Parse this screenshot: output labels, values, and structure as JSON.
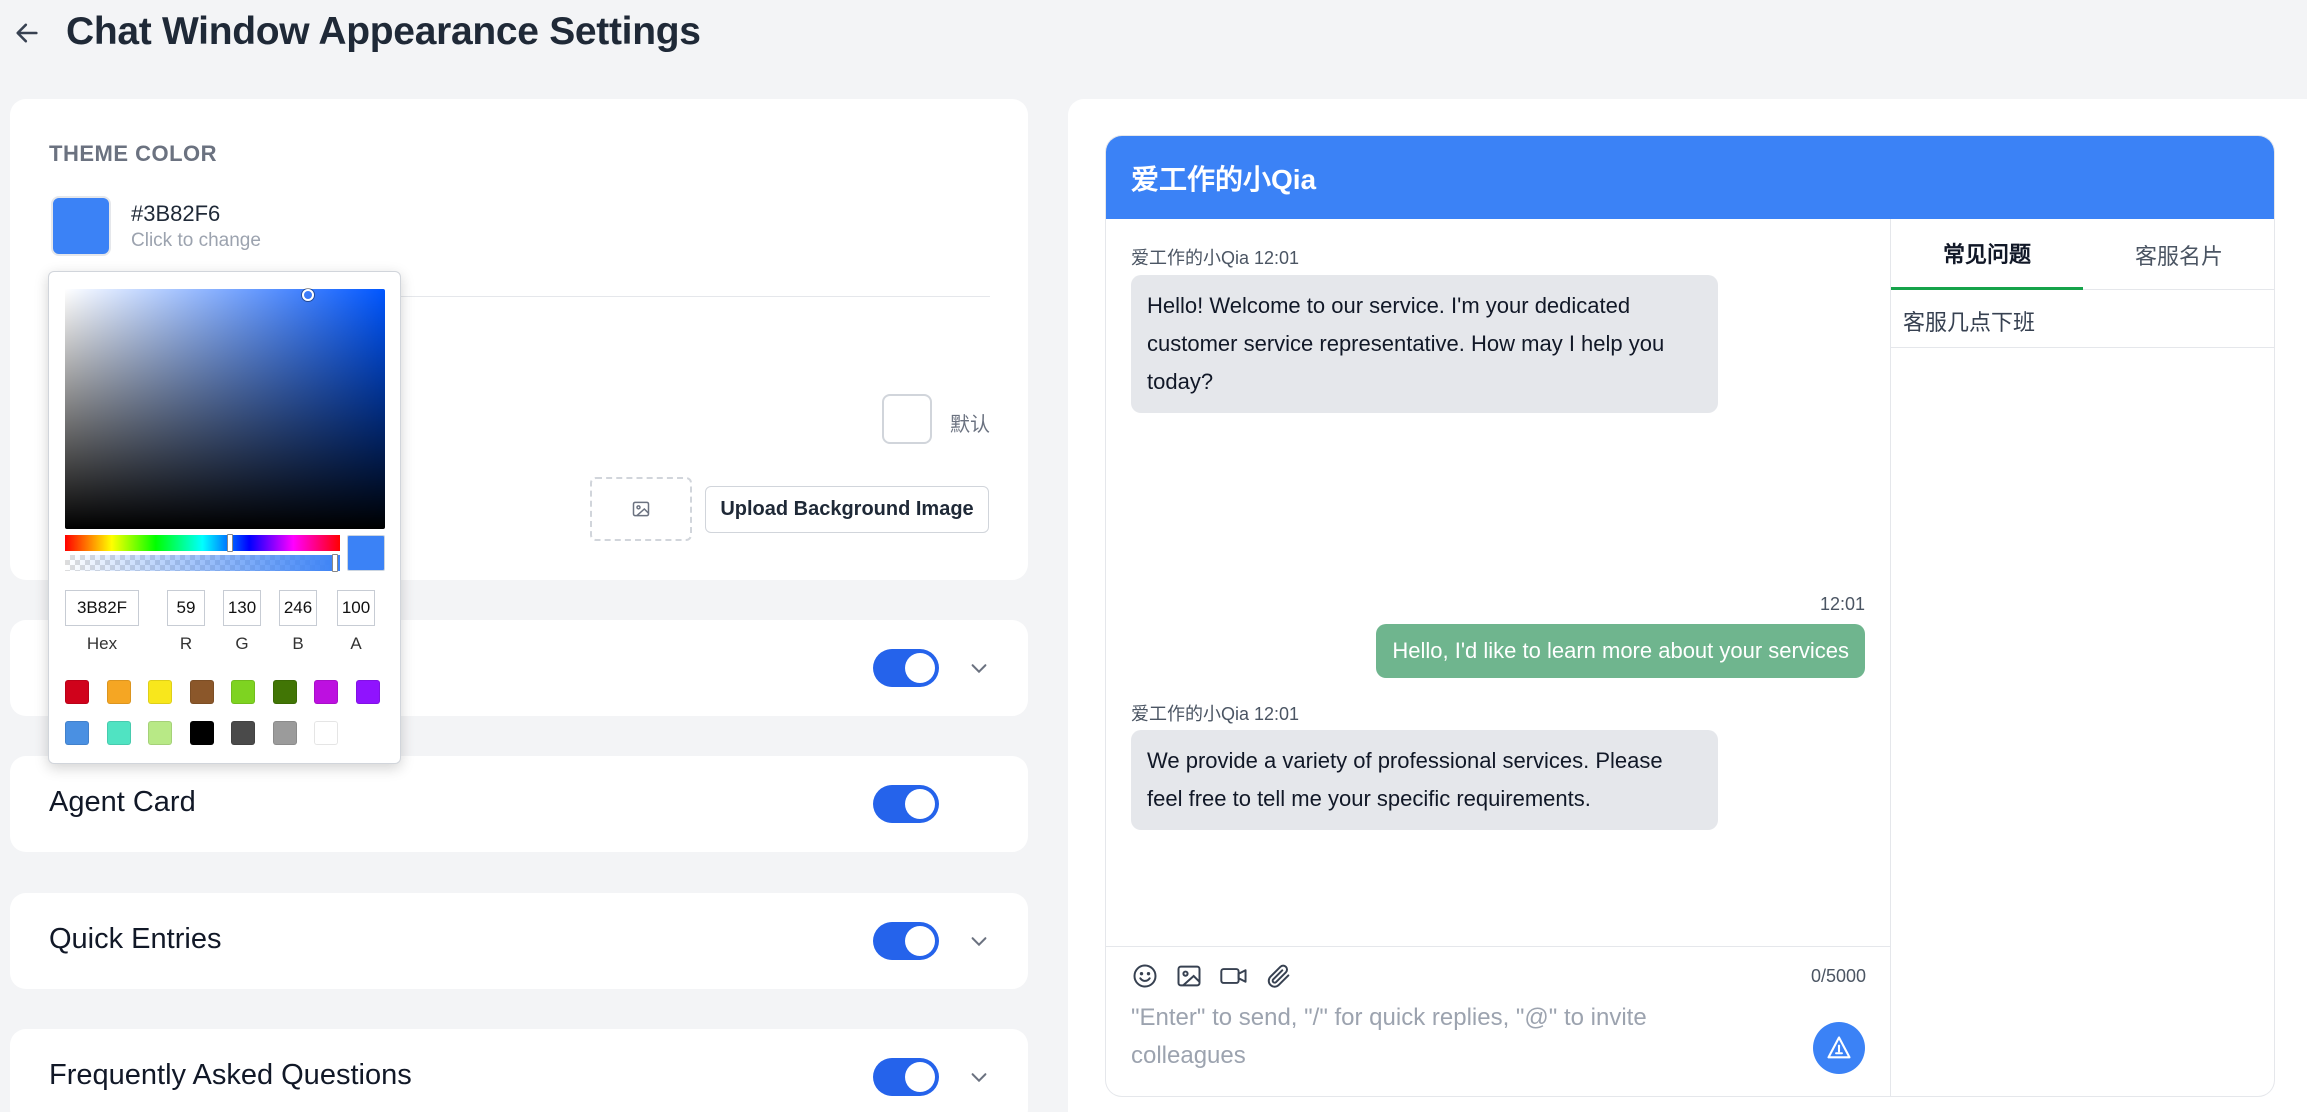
{
  "page": {
    "title": "Chat Window Appearance Settings"
  },
  "theme": {
    "section_label": "THEME COLOR",
    "hex_value": "#3B82F6",
    "hint": "Click to change",
    "default_label": "默认",
    "upload_label": "Upload Background Image",
    "color": "#3B82F6"
  },
  "picker": {
    "hex": "3B82F",
    "r": "59",
    "g": "130",
    "b": "246",
    "a": "100",
    "labels": {
      "hex": "Hex",
      "r": "R",
      "g": "G",
      "b": "B",
      "a": "A"
    },
    "presets": [
      "#d0021b",
      "#f5a623",
      "#f8e71c",
      "#8b572a",
      "#7ed321",
      "#417505",
      "#bd10e0",
      "#9013fe",
      "#4a90e2",
      "#50e3c2",
      "#b8e986",
      "#000000",
      "#4a4a4a",
      "#9b9b9b",
      "#ffffff"
    ]
  },
  "sections": [
    {
      "title": "",
      "enabled": true,
      "expandable": true
    },
    {
      "title": "Agent Card",
      "enabled": true,
      "expandable": false
    },
    {
      "title": "Quick Entries",
      "enabled": true,
      "expandable": true
    },
    {
      "title": "Frequently Asked Questions",
      "enabled": true,
      "expandable": true
    }
  ],
  "chat": {
    "title": "爱工作的小Qia",
    "messages": [
      {
        "meta": "爱工作的小Qia 12:01",
        "text": "Hello! Welcome to our service. I'm your dedicated customer service representative. How may I help you today?",
        "from": "agent"
      },
      {
        "meta": "12:01",
        "text": "Hello, I'd like to learn more about your services",
        "from": "user"
      },
      {
        "meta": "爱工作的小Qia 12:01",
        "text": "We provide a variety of professional services. Please feel free to tell me your specific requirements.",
        "from": "agent"
      }
    ],
    "tabs": [
      "常见问题",
      "客服名片"
    ],
    "faq_items": [
      "客服几点下班"
    ],
    "char_count": "0/5000",
    "input_placeholder": "\"Enter\" to send, \"/\" for quick replies, \"@\" to invite colleagues",
    "user_bubble_color": "#6fb58e"
  }
}
